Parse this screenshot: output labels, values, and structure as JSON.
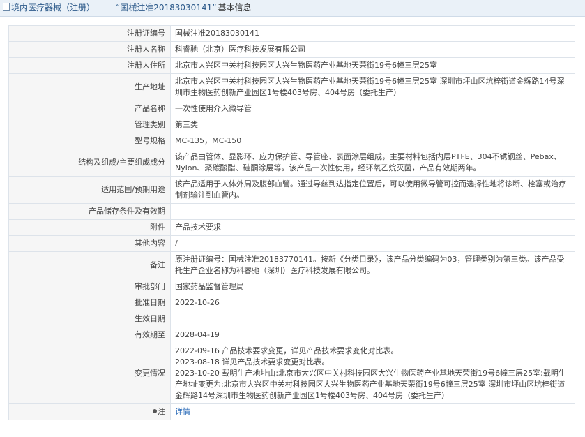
{
  "header": {
    "category": "境内医疗器械（注册）",
    "separator": "——",
    "reg_quote": "“国械注准20183030141”",
    "suffix": "基本信息"
  },
  "rows": [
    {
      "label": "注册证编号",
      "value": "国械注准20183030141"
    },
    {
      "label": "注册人名称",
      "value": "科睿驰（北京）医疗科技发展有限公司"
    },
    {
      "label": "注册人住所",
      "value": "北京市大兴区中关村科技园区大兴生物医药产业基地天荣街19号6幢三层25室"
    },
    {
      "label": "生产地址",
      "value": "北京市大兴区中关村科技园区大兴生物医药产业基地天荣街19号6幢三层25室 深圳市坪山区坑梓街道金辉路14号深圳市生物医药创新产业园区1号楼403号房、404号房（委托生产）"
    },
    {
      "label": "产品名称",
      "value": "一次性使用介入微导管"
    },
    {
      "label": "管理类别",
      "value": "第三类"
    },
    {
      "label": "型号规格",
      "value": "MC-135，MC-150"
    },
    {
      "label": "结构及组成/主要组成成分",
      "value": "该产品由管体、显影环、应力保护管、导管座、表面涂层组成，主要材料包括内层PTFE、304不锈钢丝、Pebax、Nylon、聚碳酸酯、硅酮涂层等。该产品一次性使用，经环氧乙烷灭菌，产品有效期两年。"
    },
    {
      "label": "适用范围/预期用途",
      "value": "该产品适用于人体外周及腹部血管。通过导丝到达指定位置后，可以使用微导管可控而选择性地将诊断、栓塞或治疗制剂输注到血管内。"
    },
    {
      "label": "产品储存条件及有效期",
      "value": ""
    },
    {
      "label": "附件",
      "value": "产品技术要求"
    },
    {
      "label": "其他内容",
      "value": "/"
    },
    {
      "label": "备注",
      "value": "原注册证编号：国械注准20183770141。按新《分类目录》，该产品分类编码为03，管理类别为第三类。该产品受托生产企业名称为科睿驰（深圳）医疗科技发展有限公司。"
    },
    {
      "label": "审批部门",
      "value": "国家药品监督管理局"
    },
    {
      "label": "批准日期",
      "value": "2022-10-26"
    },
    {
      "label": "生效日期",
      "value": ""
    },
    {
      "label": "有效期至",
      "value": "2028-04-19"
    }
  ],
  "changes": {
    "label": "变更情况",
    "lines": [
      "2022-09-16 产品技术要求变更，详见产品技术要求变化对比表。",
      "2023-08-18 详见产品技术要求变更对比表。",
      "2023-10-20 载明生产地址由:北京市大兴区中关村科技园区大兴生物医药产业基地天荣街19号6幢三层25室;载明生产地址变更为:北京市大兴区中关村科技园区大兴生物医药产业基地天荣街19号6幢三层25室 深圳市坪山区坑梓街道金辉路14号深圳市生物医药创新产业园区1号楼403号房、404号房（委托生产）"
    ]
  },
  "note": {
    "label": "注",
    "link_text": "详情"
  }
}
